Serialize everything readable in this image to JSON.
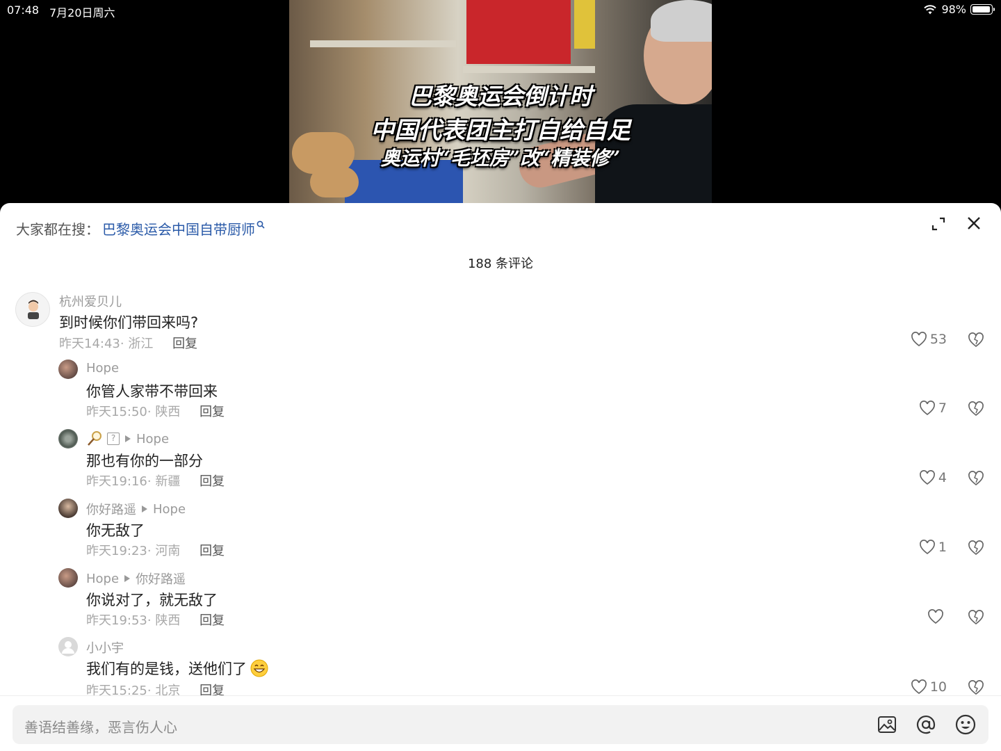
{
  "status_bar": {
    "time": "07:48",
    "date": "7月20日周六",
    "battery": "98%",
    "battery_level": 0.98
  },
  "video": {
    "caption_line1": "巴黎奥运会倒计时",
    "caption_line2": "中国代表团主打自给自足",
    "caption_line3": "奥运村“毛坯房”改“精装修”"
  },
  "panel": {
    "search_prefix": "大家都在搜：",
    "search_term": "巴黎奥运会中国自带厨师",
    "comment_count": "188 条评论"
  },
  "comments": [
    {
      "user": "杭州爱贝儿",
      "reply_to": "",
      "text": "到时候你们带回来吗?",
      "time": "昨天14:43",
      "location": "浙江",
      "reply": "回复",
      "likes": "53"
    },
    {
      "user": "Hope",
      "reply_to": "",
      "text": "你管人家带不带回来",
      "time": "昨天15:50",
      "location": "陕西",
      "reply": "回复",
      "likes": "7"
    },
    {
      "user": "",
      "badge": "?",
      "reply_to": "Hope",
      "text": "那也有你的一部分",
      "time": "昨天19:16",
      "location": "新疆",
      "reply": "回复",
      "likes": "4"
    },
    {
      "user": "你好路遥",
      "reply_to": "Hope",
      "text": "你无敌了",
      "time": "昨天19:23",
      "location": "河南",
      "reply": "回复",
      "likes": "1"
    },
    {
      "user": "Hope",
      "reply_to": "你好路遥",
      "text": "你说对了，就无敌了",
      "time": "昨天19:53",
      "location": "陕西",
      "reply": "回复",
      "likes": ""
    },
    {
      "user": "小小宇",
      "reply_to": "",
      "text": "我们有的是钱，送他们了",
      "time": "昨天15:25",
      "location": "北京",
      "reply": "回复",
      "likes": "10"
    }
  ],
  "input": {
    "placeholder": "善语结善缘，恶言伤人心"
  },
  "colors": {
    "link": "#2a5aa8",
    "meta": "#a8a8a8",
    "panel_bg": "#ffffff",
    "input_bg": "#f2f2f2"
  },
  "icons": [
    "wifi-icon",
    "battery-icon",
    "expand-icon",
    "close-icon",
    "heart-icon",
    "dislike-icon",
    "image-icon",
    "at-icon",
    "emoji-icon"
  ]
}
